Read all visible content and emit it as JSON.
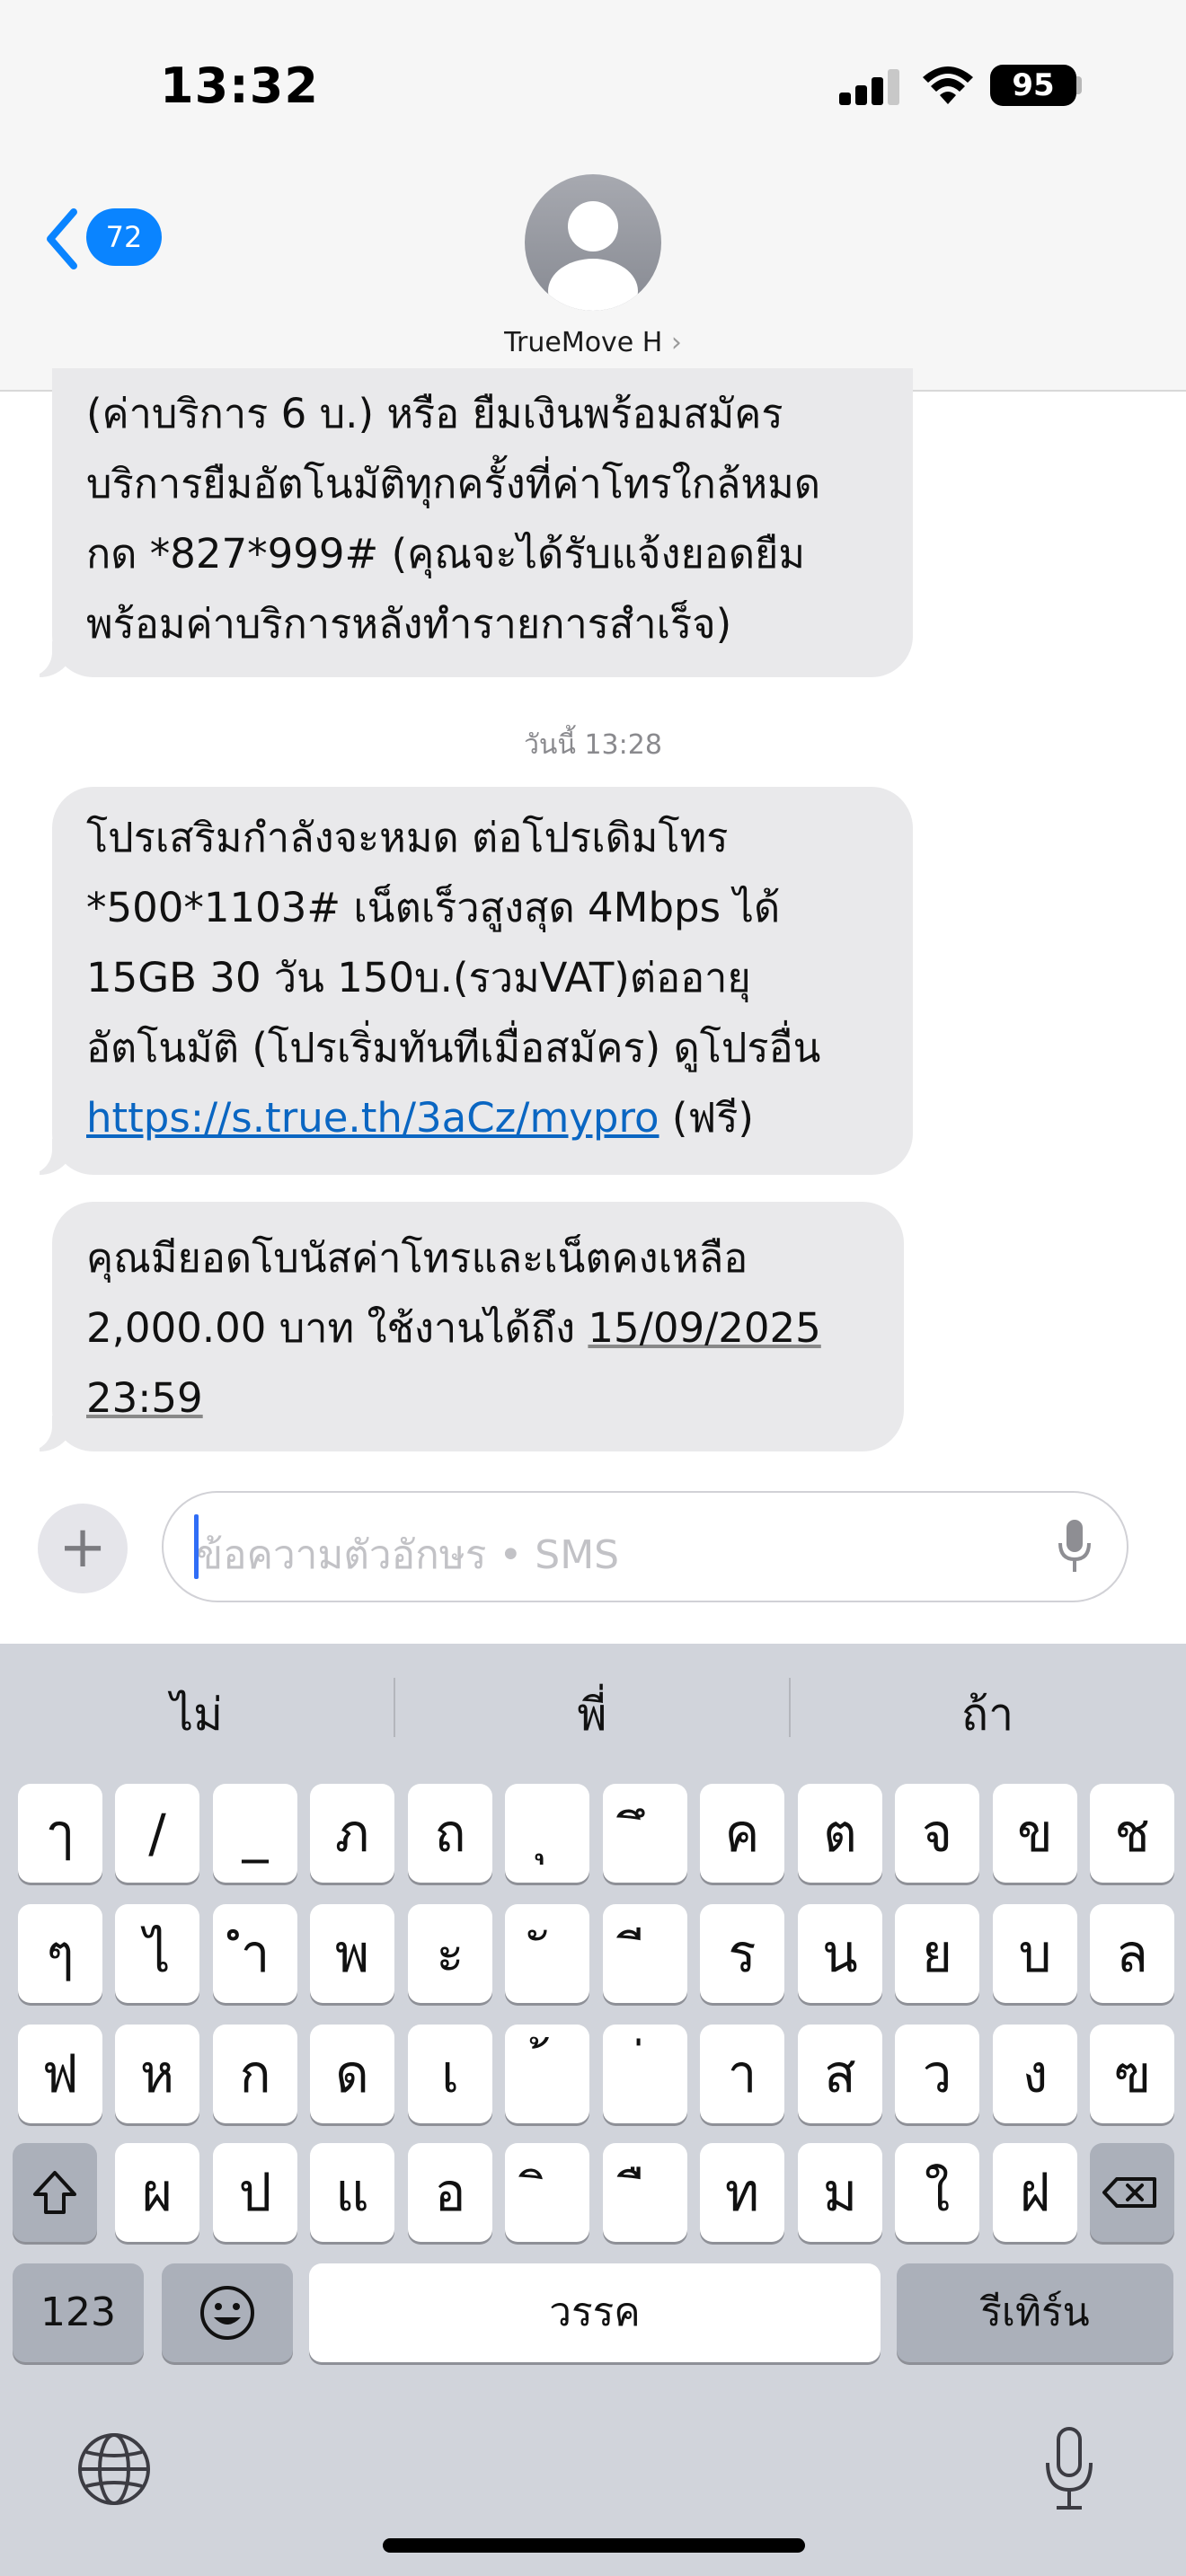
{
  "status_bar": {
    "time": "13:32",
    "battery": "95"
  },
  "header": {
    "back_badge": "72",
    "contact_name": "TrueMove H",
    "contact_chevron": "›"
  },
  "messages": [
    {
      "lines": [
        "(ค่าบริการ 6 บ.)  หรือ ยืมเงินพร้อมสมัคร",
        "บริการยืมอัตโนมัติทุกครั้งที่ค่าโทรใกล้หมด",
        "กด *827*999# (คุณจะได้รับแจ้งยอดยืม",
        "พร้อมค่าบริการหลังทำรายการสำเร็จ)"
      ]
    },
    {
      "timestamp": "วันนี้ 13:28",
      "lines": [
        "โปรเสริมกำลังจะหมด ต่อโปรเดิมโทร",
        "*500*1103# เน็ตเร็วสูงสุด 4Mbps ได้",
        "15GB 30 วัน 150บ.(รวมVAT)ต่ออายุ",
        "อัตโนมัติ (โปรเริ่มทันทีเมื่อสมัคร) ดูโปรอื่น"
      ],
      "link": "https://s.true.th/3aCz/mypro",
      "link_suffix": " (ฟรี)"
    },
    {
      "line1": "คุณมียอดโบนัสค่าโทรและเน็ตคงเหลือ",
      "line2_text": "2,000.00 บาท  ใช้งานได้ถึง ",
      "date": "15/09/2025",
      "time": "23:59"
    }
  ],
  "compose": {
    "plus": "+",
    "placeholder": "ข้อความตัวอักษร • SMS"
  },
  "keyboard": {
    "suggestions": [
      "ไม่",
      "พี่",
      "ถ้า"
    ],
    "row1": [
      "ๅ",
      "/",
      "_",
      "ภ",
      "ถ",
      "ุ",
      "ึ",
      "ค",
      "ต",
      "จ",
      "ข",
      "ช"
    ],
    "row2": [
      "ๆ",
      "ไ",
      "ำ",
      "พ",
      "ะ",
      "ั",
      "ี",
      "ร",
      "น",
      "ย",
      "บ",
      "ล"
    ],
    "row3": [
      "ฟ",
      "ห",
      "ก",
      "ด",
      "เ",
      "้",
      "่",
      "า",
      "ส",
      "ว",
      "ง",
      "ฃ"
    ],
    "row4": [
      "ผ",
      "ป",
      "แ",
      "อ",
      "ิ",
      "ื",
      "ท",
      "ม",
      "ใ",
      "ฝ"
    ],
    "numbers_key": "123",
    "space_key": "วรรค",
    "return_key": "รีเทิร์น"
  }
}
